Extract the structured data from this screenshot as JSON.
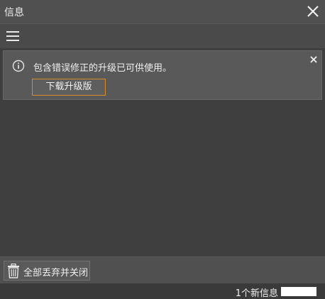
{
  "window": {
    "title": "信息"
  },
  "notice": {
    "message": "包含错误修正的升级已可供使用。",
    "download_label": "下载升级版"
  },
  "footer": {
    "discard_label": "全部丢弃并关闭"
  },
  "status": {
    "text": "1个新信息"
  },
  "colors": {
    "titlebar": "#505050",
    "background": "#3f3f3f",
    "notice_bg": "#595959",
    "accent_border": "#d98c2a",
    "status_bar": "#3a3a3a"
  },
  "icons": {
    "close": "close-icon",
    "menu": "hamburger-menu-icon",
    "info": "info-icon",
    "dismiss": "dismiss-icon",
    "trash": "trash-icon"
  }
}
